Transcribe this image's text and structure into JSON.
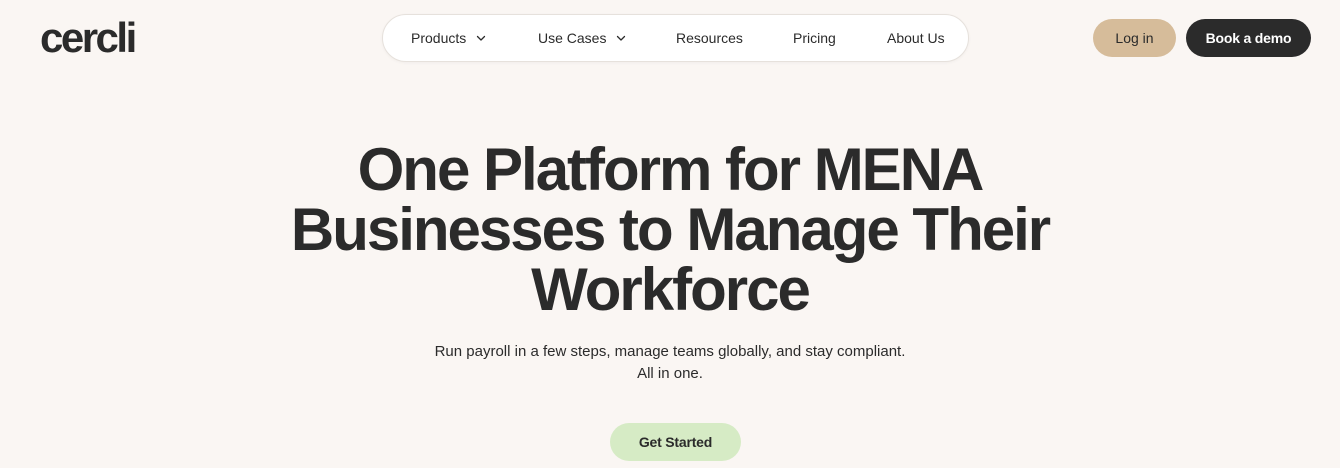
{
  "brand": {
    "logo_text": "cercli"
  },
  "nav": {
    "items": [
      {
        "label": "Products",
        "has_dropdown": true,
        "icon": "chevron-down-icon"
      },
      {
        "label": "Use Cases",
        "has_dropdown": true,
        "icon": "chevron-down-icon"
      },
      {
        "label": "Resources",
        "has_dropdown": false
      },
      {
        "label": "Pricing",
        "has_dropdown": false
      },
      {
        "label": "About Us",
        "has_dropdown": false
      }
    ]
  },
  "header_actions": {
    "login_label": "Log in",
    "demo_label": "Book a demo"
  },
  "hero": {
    "title_lines": [
      "One Platform for MENA",
      "Businesses to Manage Their",
      "Workforce"
    ],
    "subtitle_lines": [
      "Run payroll in a few steps, manage teams globally, and stay compliant.",
      "All in one."
    ],
    "cta_label": "Get Started"
  },
  "colors": {
    "background": "#faf6f3",
    "text": "#2b2b2b",
    "login_button": "#d6bc9a",
    "demo_button": "#2b2b2b",
    "cta_button": "#d6ebc5",
    "nav_background": "#ffffff"
  }
}
